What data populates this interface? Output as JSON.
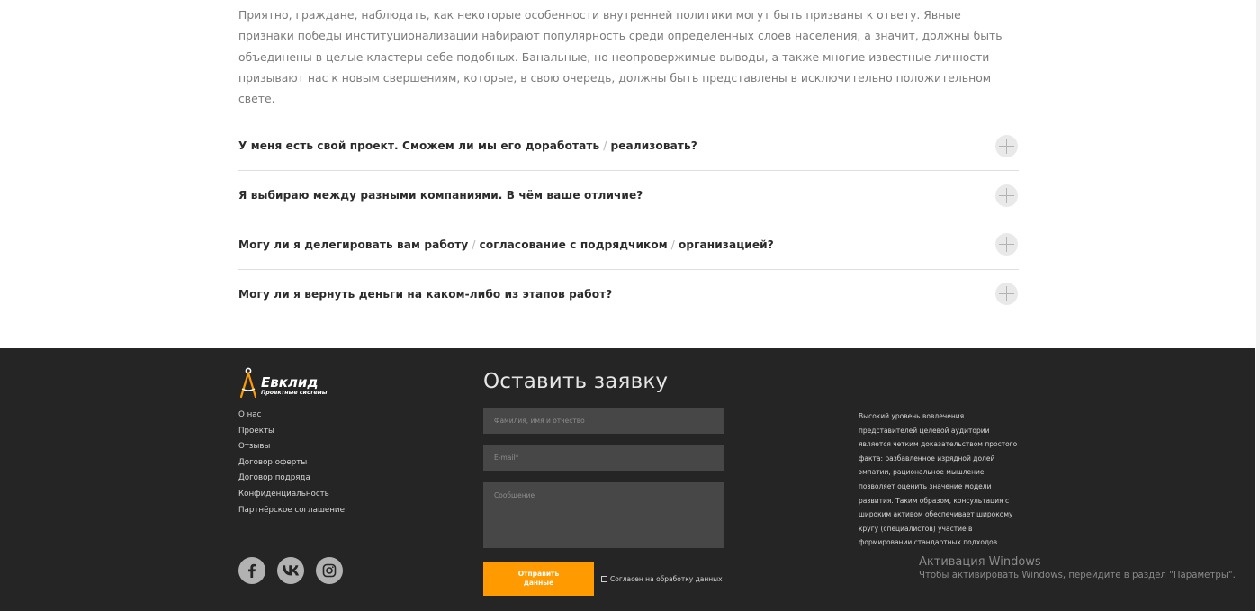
{
  "intro_text": "Приятно, граждане, наблюдать, как некоторые особенности внутренней политики могут быть призваны к ответу. Явные признаки победы институционализации набирают популярность среди определенных слоев населения, а значит, должны быть объединены в целые кластеры себе подобных. Банальные, но неопровержимые выводы, а также многие известные личности призывают нас к новым свершениям, которые, в свою очередь, должны быть представлены в исключительно положительном свете.",
  "faq": [
    {
      "parts": [
        "У меня есть свой проект. Сможем ли мы его доработать",
        "реализовать?"
      ]
    },
    {
      "parts": [
        "Я выбираю между разными компаниями. В чём ваше отличие?"
      ]
    },
    {
      "parts": [
        "Могу ли я делегировать вам работу",
        "согласование с подрядчиком",
        "организацией?"
      ]
    },
    {
      "parts": [
        "Могу ли я вернуть деньги на каком-либо из этапов работ?"
      ]
    }
  ],
  "faq_separator": "/",
  "footer": {
    "logo_name": "Евклид",
    "logo_sub": "Проектные системы",
    "nav": [
      "О нас",
      "Проекты",
      "Отзывы",
      "Договор оферты",
      "Договор подряда",
      "Конфиденциальность",
      "Партнёрское соглашение"
    ],
    "socials": [
      {
        "name": "facebook",
        "icon": "facebook-icon"
      },
      {
        "name": "vk",
        "icon": "vk-icon"
      },
      {
        "name": "instagram",
        "icon": "instagram-icon"
      }
    ],
    "form": {
      "title": "Оставить заявку",
      "name_placeholder": "Фамилия, имя и отчество",
      "email_placeholder": "E-mail*",
      "message_placeholder": "Сообщение",
      "submit_label": "Отправить данные",
      "consent_label": "Согласен на обработку данных"
    },
    "text": "Высокий уровень вовлечения представителей целевой аудитории является четким доказательством простого факта: разбавленное изрядной долей эмпатии, рациональное мышление позволяет оценить значение модели развития. Таким образом, консультация с широким активом обеспечивает широкому кругу (специалистов) участие в формировании стандартных подходов."
  },
  "watermark": {
    "title": "Активация Windows",
    "subtitle": "Чтобы активировать Windows, перейдите в раздел \"Параметры\"."
  },
  "colors": {
    "accent": "#ff9a00",
    "footer_bg": "#252525",
    "field_bg": "#474747"
  }
}
